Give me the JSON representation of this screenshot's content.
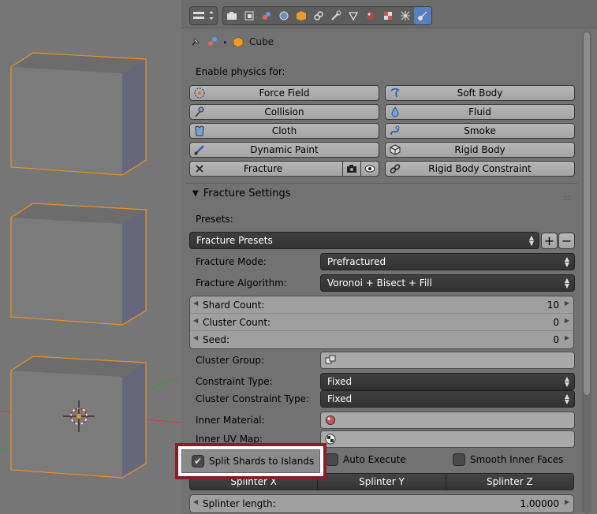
{
  "context": {
    "object_name": "Cube"
  },
  "physics": {
    "heading": "Enable physics for:",
    "left": [
      "Force Field",
      "Collision",
      "Cloth",
      "Dynamic Paint",
      "Fracture"
    ],
    "right": [
      "Soft Body",
      "Fluid",
      "Smoke",
      "Rigid Body",
      "Rigid Body Constraint"
    ]
  },
  "fracture_settings": {
    "title": "Fracture Settings",
    "presets_label": "Presets:",
    "presets_value": "Fracture Presets",
    "mode_label": "Fracture Mode:",
    "mode_value": "Prefractured",
    "algorithm_label": "Fracture Algorithm:",
    "algorithm_value": "Voronoi + Bisect + Fill",
    "shard_count_label": "Shard Count:",
    "shard_count_value": "10",
    "cluster_count_label": "Cluster Count:",
    "cluster_count_value": "0",
    "seed_label": "Seed:",
    "seed_value": "0",
    "cluster_group_label": "Cluster Group:",
    "constraint_type_label": "Constraint Type:",
    "constraint_type_value": "Fixed",
    "cluster_constraint_type_label": "Cluster Constraint Type:",
    "cluster_constraint_type_value": "Fixed",
    "inner_material_label": "Inner Material:",
    "inner_uv_map_label": "Inner UV Map:",
    "split_shards_label": "Split Shards to Islands",
    "auto_execute_label": "Auto Execute",
    "smooth_inner_faces_label": "Smooth Inner Faces",
    "splinter_tabs": [
      "Splinter X",
      "Splinter Y",
      "Splinter Z"
    ],
    "splinter_length_label": "Splinter length:",
    "splinter_length_value": "1.00000"
  },
  "colors": {
    "selection_outline": "#e8922a",
    "highlight_frame": "#8b1c2b",
    "active_tab": "#5680c2"
  }
}
